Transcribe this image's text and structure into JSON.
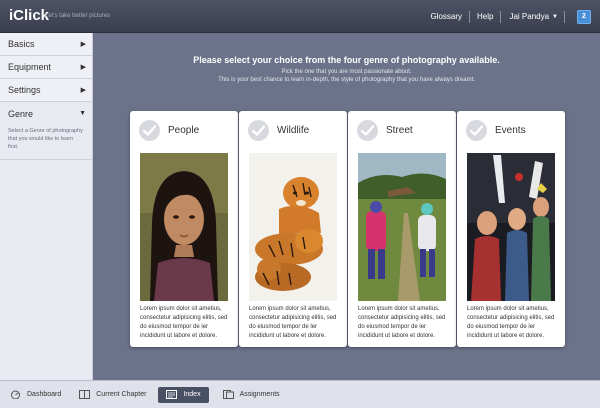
{
  "header": {
    "brand": "iClick",
    "tagline": "Let's take better pictures",
    "links": {
      "glossary": "Glossary",
      "help": "Help"
    },
    "user": "Jai Pandya",
    "notifications": "2"
  },
  "sidebar": {
    "items": [
      {
        "label": "Basics"
      },
      {
        "label": "Equipment"
      },
      {
        "label": "Settings"
      },
      {
        "label": "Genre"
      }
    ],
    "genre_description": "Select a Genre of photography that you would like to learn first."
  },
  "main": {
    "headline": "Please select your choice from the four genre of photography available.",
    "subline1": "Pick the one that you are most passionate about.",
    "subline2": "This is your best chance to learn in-depth, the style of photography that you have always dreamt.",
    "cards": [
      {
        "title": "People",
        "text": "Lorem ipsum dolor sit ametius, consectetur adipisicing elitis, sed do eiusmod tempor de ler incididunt ut labore et dolore."
      },
      {
        "title": "Wildlife",
        "text": "Lorem ipsum dolor sit ametius, consectetur adipisicing elitis, sed do eiusmod tempor de ler incididunt ut labore et dolore."
      },
      {
        "title": "Street",
        "text": "Lorem ipsum dolor sit ametius, consectetur adipisicing elitis, sed do eiusmod tempor de ler incididunt ut labore et dolore."
      },
      {
        "title": "Events",
        "text": "Lorem ipsum dolor sit ametius, consectetur adipisicing elitis, sed do eiusmod tempor de ler incididunt ut labore et dolore."
      }
    ]
  },
  "footer": {
    "dashboard": "Dashboard",
    "current_chapter": "Current Chapter",
    "index": "Index",
    "assignments": "Assignments"
  },
  "colors": {
    "topbar": "#3f4354",
    "main_bg": "#6b7289",
    "sidebar_bg": "#e7eaf1",
    "accent": "#4a90d9"
  }
}
